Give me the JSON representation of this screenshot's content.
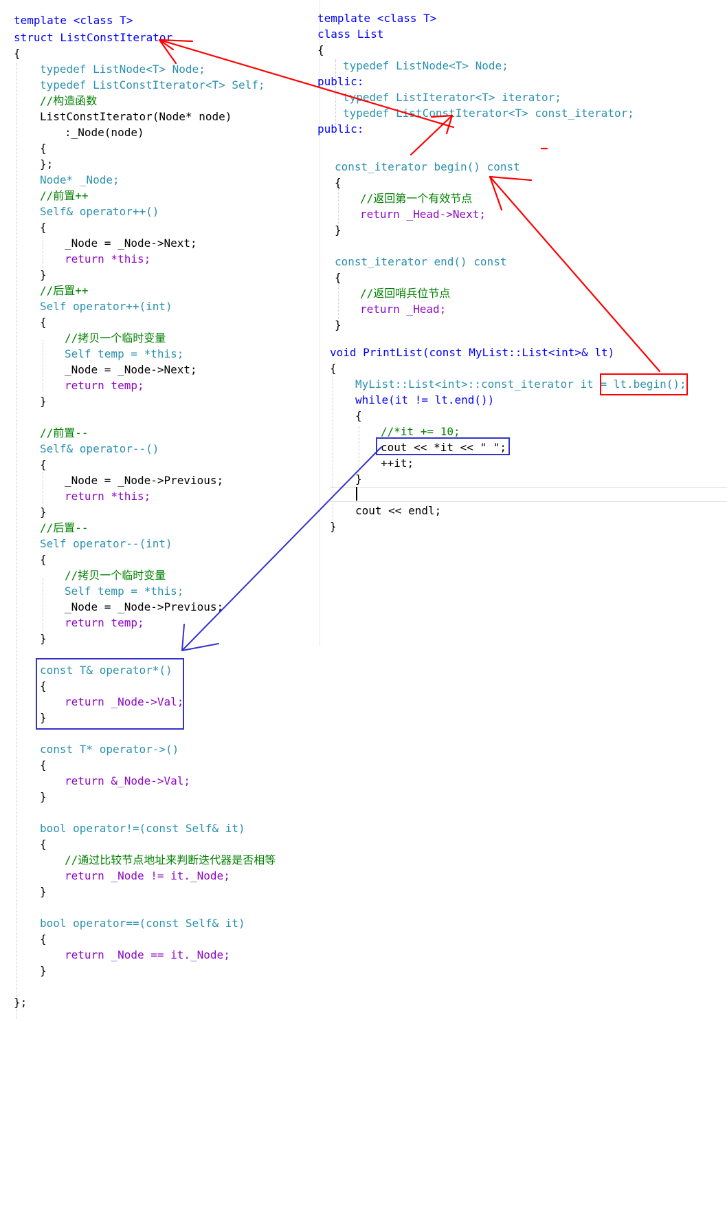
{
  "left_code": [
    "template <class T>",
    "struct ListConstIterator",
    "{",
    "typedef ListNode<T> Node;",
    "typedef ListConstIterator<T> Self;",
    "//构造函数",
    "ListConstIterator(Node* node)",
    ":_Node(node)",
    "{",
    "};",
    "Node* _Node;",
    "//前置++",
    "Self& operator++()",
    "{",
    "_Node = _Node->Next;",
    "return *this;",
    "}",
    "//后置++",
    "Self operator++(int)",
    "{",
    "//拷贝一个临时变量",
    "Self temp = *this;",
    "_Node = _Node->Next;",
    "return temp;",
    "}",
    "//前置--",
    "Self& operator--()",
    "{",
    "_Node = _Node->Previous;",
    "return *this;",
    "}",
    "//后置--",
    "Self operator--(int)",
    "{",
    "//拷贝一个临时变量",
    "Self temp = *this;",
    "_Node = _Node->Previous;",
    "return temp;",
    "}",
    "const T& operator*()",
    "{",
    "return _Node->Val;",
    "}",
    "const T* operator->()",
    "{",
    "return &_Node->Val;",
    "}",
    "bool operator!=(const Self& it)",
    "{",
    "//通过比较节点地址来判断迭代器是否相等",
    "return _Node != it._Node;",
    "}",
    "bool operator==(const Self& it)",
    "{",
    "return _Node == it._Node;",
    "}",
    "};"
  ],
  "right_code": [
    "template <class T>",
    "class List",
    "{",
    "typedef ListNode<T> Node;",
    "public:",
    "typedef ListIterator<T> iterator;",
    "typedef ListConstIterator<T> const_iterator;",
    "public:",
    "const_iterator begin() const",
    "{",
    "//返回第一个有效节点",
    "return _Head->Next;",
    "}",
    "const_iterator end() const",
    "{",
    "//返回哨兵位节点",
    "return _Head;",
    "}",
    "void PrintList(const MyList::List<int>& lt)",
    "{",
    "MyList::List<int>::const_iterator it = lt.begin();",
    "while(it != lt.end())",
    "{",
    "//*it += 10;",
    "cout << *it << \" \";",
    "++it;",
    "}",
    "cout << endl;",
    "}"
  ],
  "colors": {
    "keyword": "#0000ff",
    "type": "#2b91af",
    "comment": "#008000",
    "string": "#a31515",
    "return_keyword": "#8f08c4",
    "red_annotation": "#ff0000",
    "blue_annotation": "#3333cc"
  }
}
